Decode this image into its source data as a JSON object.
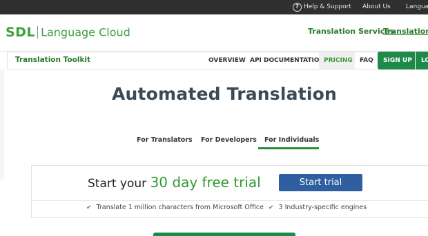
{
  "topbar": {
    "help_icon": "question-circle-icon",
    "help_label": "Help & Support",
    "about_label": "About Us",
    "language_label": "Language"
  },
  "header": {
    "logo_sdl": "SDL",
    "logo_product": "Language Cloud",
    "links": {
      "translation_services": "Translation Services",
      "translation_toolkit": "Translation To"
    }
  },
  "subnav": {
    "product_name": "Translation Toolkit",
    "items": [
      {
        "label": "OVERVIEW"
      },
      {
        "label": "API DOCUMENTATION"
      },
      {
        "label": "PRICING",
        "active": true
      },
      {
        "label": "FAQ"
      }
    ],
    "signup_label": "SIGN UP",
    "login_label": "LOG"
  },
  "hero": {
    "title": "Automated Translation"
  },
  "tabs": {
    "items": [
      {
        "label": "For Translators"
      },
      {
        "label": "For Developers"
      },
      {
        "label": "For Individuals",
        "active": true
      }
    ]
  },
  "trial": {
    "prefix": "Start your ",
    "highlight": "30 day free trial",
    "button_label": "Start trial",
    "features": [
      {
        "icon": "check-icon",
        "label": "Translate 1 million characters from Microsoft Office"
      },
      {
        "icon": "check-icon",
        "label": "3 Industry-specific engines"
      }
    ]
  },
  "colors": {
    "brand_green": "#3ea03e",
    "link_green": "#2a7a2a",
    "button_green": "#1e8a4a",
    "trial_blue": "#2f5fa0",
    "topbar": "#2f2f2f"
  }
}
